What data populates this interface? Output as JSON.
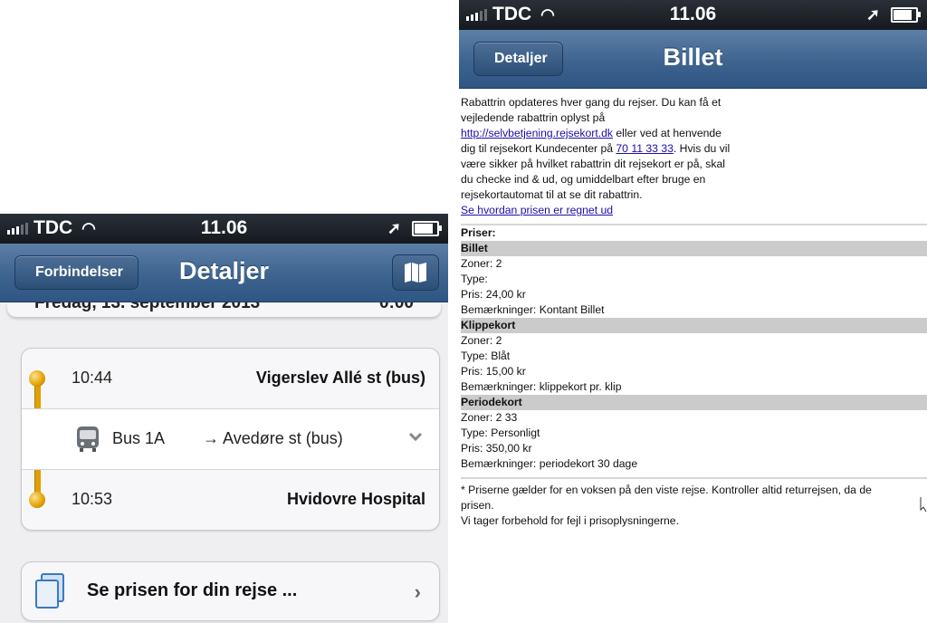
{
  "left": {
    "status": {
      "carrier": "TDC",
      "time": "11.06"
    },
    "nav": {
      "back_label": "Forbindelser",
      "title": "Detaljer"
    },
    "date_partial": {
      "left": "Fredag, 13. september 2013",
      "right": "0:00"
    },
    "trip": {
      "departure": {
        "time": "10:44",
        "stop": "Vigerslev Allé st (bus)"
      },
      "leg": {
        "line": "Bus 1A",
        "direction": "→ Avedøre st (bus)"
      },
      "arrival": {
        "time": "10:53",
        "stop": "Hvidovre Hospital"
      }
    },
    "price_cell": {
      "label": "Se prisen for din rejse ...",
      "arrow": "›"
    },
    "colors": {
      "accent": "#e2a000",
      "navbar": "#3d648f"
    }
  },
  "right": {
    "status": {
      "carrier": "TDC",
      "time": "11.06"
    },
    "nav": {
      "back_label": "Detaljer",
      "title": "Billet"
    },
    "intro": {
      "p1": "Rabattrin opdateres hver gang du rejser. Du kan få et vejledende rabattrin oplyst på",
      "link1": "http://selvbetjening.rejsekort.dk",
      "p2": " eller ved at henvende dig til rejsekort Kundecenter på ",
      "phone": "70 11 33 33",
      "p3": ". Hvis du vil være sikker på hvilket rabattrin dit rejsekort er på, skal du checke ind & ud, og umiddelbart efter bruge en rejsekortautomat til at se dit rabattrin.",
      "link2": "Se hvordan prisen er regnet ud"
    },
    "prices_header": "Priser:",
    "tickets": [
      {
        "name": "Billet",
        "zones": "Zoner: 2",
        "type": "Type:",
        "price": "Pris: 24,00 kr",
        "notes": "Bemærkninger: Kontant Billet"
      },
      {
        "name": "Klippekort",
        "zones": "Zoner: 2",
        "type": "Type: Blåt",
        "price": "Pris: 15,00 kr",
        "notes": "Bemærkninger: klippekort pr. klip"
      },
      {
        "name": "Periodekort",
        "zones": "Zoner: 2 33",
        "type": "Type: Personligt",
        "price": "Pris: 350,00 kr",
        "notes": "Bemærkninger: periodekort 30 dage"
      }
    ],
    "footer": {
      "line1": "* Priserne gælder for en voksen på den viste rejse. Kontroller altid returrejsen, da de",
      "line2": "prisen.",
      "line3": "Vi tager forbehold for fejl i prisoplysningerne."
    }
  }
}
